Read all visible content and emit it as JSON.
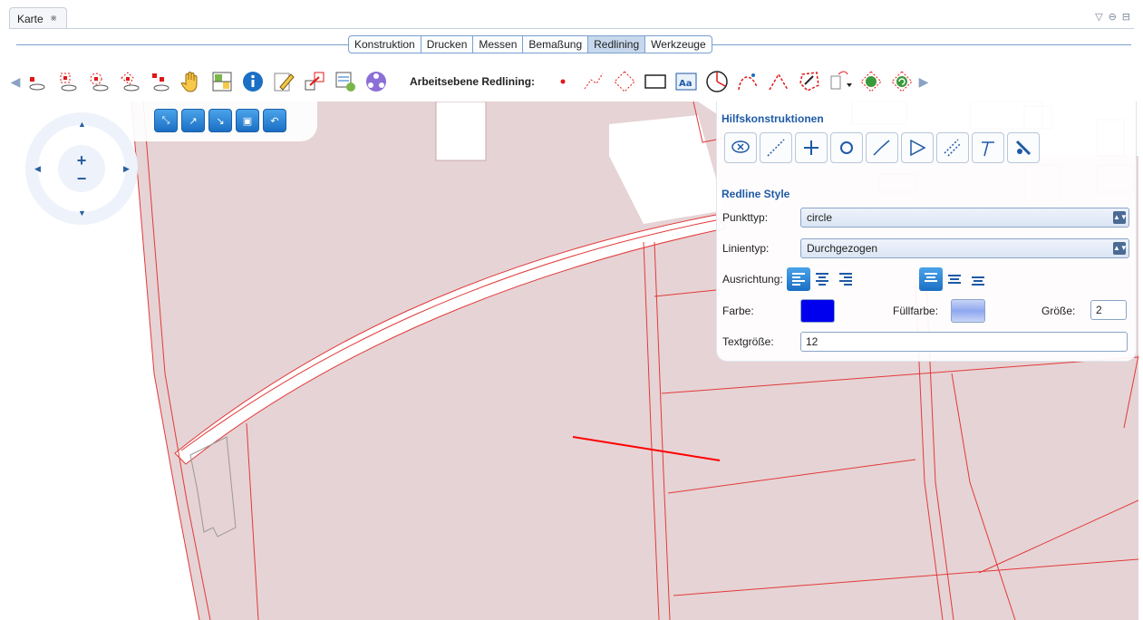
{
  "view": {
    "tab_label": "Karte",
    "close_glyph": "⨳"
  },
  "tabs": [
    {
      "label": "Konstruktion",
      "active": false
    },
    {
      "label": "Drucken",
      "active": false
    },
    {
      "label": "Messen",
      "active": false
    },
    {
      "label": "Bemaßung",
      "active": false
    },
    {
      "label": "Redlining",
      "active": true
    },
    {
      "label": "Werkzeuge",
      "active": false
    }
  ],
  "toolbar": {
    "label": "Arbeitsebene Redlining:",
    "left_icons": [
      "select-point-icon",
      "select-area-icon",
      "select-circle-icon",
      "select-polygon-icon",
      "select-rect-icon",
      "hand-pan-icon",
      "feature-table-icon",
      "info-icon",
      "edit-icon",
      "transfer-icon",
      "layer-list-icon",
      "network-icon"
    ],
    "right_icons": [
      "point-icon",
      "polyline-icon",
      "polygon-icon",
      "rectangle-icon",
      "text-icon",
      "circle-segment-icon",
      "curve-icon",
      "arc-icon",
      "freehand-icon",
      "copy-menu-icon",
      "rotate-icon",
      "redo-icon"
    ]
  },
  "panel": {
    "hilfs_title": "Hilfskonstruktionen",
    "style_title": "Redline Style",
    "punkttyp_label": "Punkttyp:",
    "punkttyp_value": "circle",
    "linientyp_label": "Linientyp:",
    "linientyp_value": "Durchgezogen",
    "ausrichtung_label": "Ausrichtung:",
    "farbe_label": "Farbe:",
    "fuellfarbe_label": "Füllfarbe:",
    "groesse_label": "Größe:",
    "groesse_value": "2",
    "textgroesse_label": "Textgröße:",
    "textgroesse_value": "12",
    "farbe_color": "#0000ee",
    "fuellfarbe_color": "#8ea8f0"
  },
  "colors": {
    "parcel_fill": "#e6d3d5",
    "parcel_line": "#e23a3a",
    "accent": "#1e5aa6",
    "redline": "#ff0000"
  }
}
